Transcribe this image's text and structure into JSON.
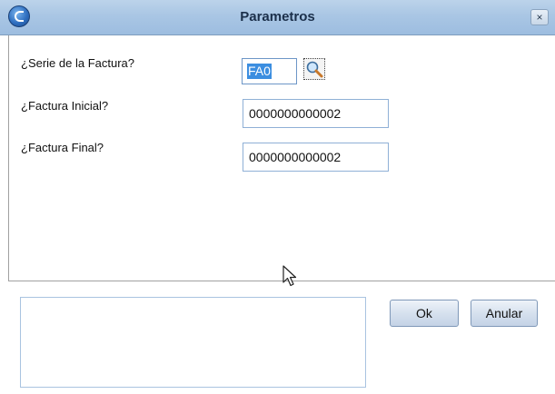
{
  "window": {
    "title": "Parametros",
    "close_label": "×",
    "icons": {
      "app": "app-logo-icon",
      "close": "close-icon",
      "lookup": "magnifier-icon",
      "cursor": "mouse-cursor-icon"
    }
  },
  "form": {
    "fields": [
      {
        "label": "¿Serie de la Factura?",
        "value": "FA0"
      },
      {
        "label": "¿Factura Inicial?",
        "value": "0000000000002"
      },
      {
        "label": "¿Factura Final?",
        "value": "0000000000002"
      }
    ]
  },
  "actions": {
    "ok_label": "Ok",
    "cancel_label": "Anular"
  },
  "colors": {
    "titlebar": "#a9c6e4",
    "field_border": "#8fb0d6",
    "selection": "#3c8ee0"
  }
}
